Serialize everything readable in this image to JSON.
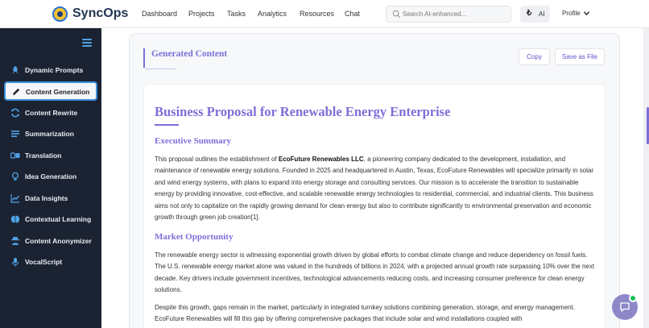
{
  "app": {
    "name": "SyncOps"
  },
  "nav": {
    "items": [
      "Dashboard",
      "Projects",
      "Tasks",
      "Analytics",
      "Resources",
      "Chat"
    ]
  },
  "search": {
    "placeholder": "Search AI-enhanced..."
  },
  "ai_button": {
    "label": "AI"
  },
  "profile": {
    "label": "Profile"
  },
  "sidebar": {
    "items": [
      {
        "label": "Dynamic Prompts",
        "icon": "rocket-icon",
        "active": false
      },
      {
        "label": "Content Generation",
        "icon": "pen-icon",
        "active": true
      },
      {
        "label": "Content Rewrite",
        "icon": "refresh-icon",
        "active": false
      },
      {
        "label": "Summarization",
        "icon": "list-icon",
        "active": false
      },
      {
        "label": "Translation",
        "icon": "translate-icon",
        "active": false
      },
      {
        "label": "Idea Generation",
        "icon": "lightbulb-icon",
        "active": false
      },
      {
        "label": "Data Insights",
        "icon": "chart-line-icon",
        "active": false
      },
      {
        "label": "Contextual Learning",
        "icon": "brain-icon",
        "active": false
      },
      {
        "label": "Content Anonymizer",
        "icon": "user-secret-icon",
        "active": false
      },
      {
        "label": "VocalScript",
        "icon": "microphone-icon",
        "active": false
      }
    ]
  },
  "generated": {
    "heading": "Generated Content",
    "copy_label": "Copy",
    "save_label": "Save as File"
  },
  "document": {
    "title": "Business Proposal for Renewable Energy Enterprise",
    "sections": [
      {
        "heading": "Executive Summary",
        "para_before": "This proposal outlines the establishment of ",
        "para_bold": "EcoFuture Renewables LLC",
        "para_after": ", a pioneering company dedicated to the development, installation, and maintenance of renewable energy solutions. Founded in 2025 and headquartered in Austin, Texas, EcoFuture Renewables will specialize primarily in solar and wind energy systems, with plans to expand into energy storage and consulting services. Our mission is to accelerate the transition to sustainable energy by providing innovative, cost-effective, and scalable renewable energy technologies to residential, commercial, and industrial clients. This business aims not only to capitalize on the rapidly growing demand for clean energy but also to contribute significantly to environmental preservation and economic growth through green job creation[1]."
      },
      {
        "heading": "Market Opportunity",
        "para1": "The renewable energy sector is witnessing exponential growth driven by global efforts to combat climate change and reduce dependency on fossil fuels. The U.S. renewable energy market alone was valued in the hundreds of billions in 2024, with a projected annual growth rate surpassing 10% over the next decade. Key drivers include government incentives, technological advancements reducing costs, and increasing consumer preference for clean energy solutions.",
        "para2": "Despite this growth, gaps remain in the market, particularly in integrated turnkey solutions combining generation, storage, and energy management. EcoFuture Renewables will fill this gap by offering comprehensive packages that include solar and wind installations coupled with"
      }
    ]
  },
  "colors": {
    "accent": "#7b6fd8",
    "sidebar_bg": "#1b2333",
    "sidebar_accent": "#4fa3e6",
    "online": "#19c15a"
  }
}
